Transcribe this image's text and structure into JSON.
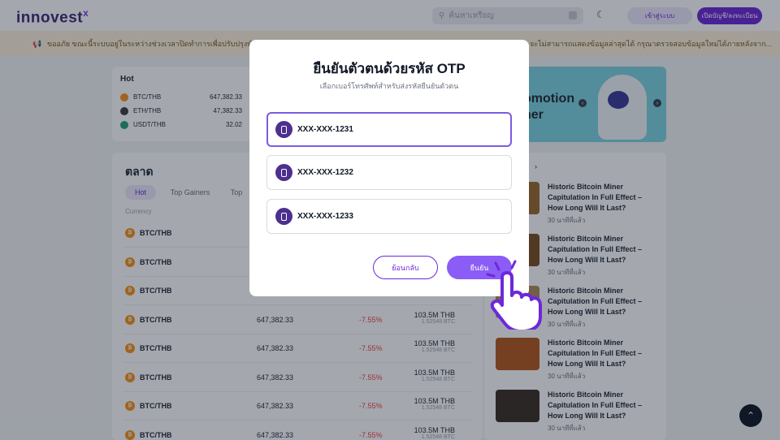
{
  "header": {
    "logo": "innovest",
    "logo_mark": "x",
    "search_placeholder": "ค้นหาเหรียญ",
    "login": "เข้าสู่ระบบ",
    "open_account": "เปิดบัญชี/ลงทะเบียน"
  },
  "notice": {
    "text_left": "ขออภัย ขณะนี้ระบบอยู่ในระหว่างช่วงเวลาปิดทำการเพื่อปรับปรุงพัฒนาการ",
    "text_right": "จะไม่สามารถแสดงข้อมูลล่าสุดได้ กรุณาตรวจสอบข้อมูลใหม่ได้ภายหลังจาก..."
  },
  "hot": {
    "title": "Hot",
    "items": [
      {
        "pair": "BTC/THB",
        "price": "647,382.33",
        "color": "#f7931a",
        "icon": "bitcoin-icon"
      },
      {
        "pair": "ETH/THB",
        "price": "47,382.33",
        "color": "#3c3c3d",
        "icon": "ethereum-icon"
      },
      {
        "pair": "USDT/THB",
        "price": "32.02",
        "color": "#26a17b",
        "icon": "tether-icon"
      }
    ]
  },
  "promo": {
    "line1": "omotion",
    "line2": "ner"
  },
  "market": {
    "title": "ตลาด",
    "tabs": [
      "Hot",
      "Top Gainers",
      "Top"
    ],
    "column_currency": "Currency",
    "rows": [
      {
        "name": "BTC/THB",
        "price": "",
        "change": "",
        "vol": "",
        "vol_sub": ""
      },
      {
        "name": "BTC/THB",
        "price": "",
        "change": "",
        "vol": "",
        "vol_sub": ""
      },
      {
        "name": "BTC/THB",
        "price": "",
        "change": "",
        "vol": "",
        "vol_sub": ""
      },
      {
        "name": "BTC/THB",
        "price": "647,382.33",
        "change": "-7.55%",
        "vol": "103.5M THB",
        "vol_sub": "1.52548 BTC"
      },
      {
        "name": "BTC/THB",
        "price": "647,382.33",
        "change": "-7.55%",
        "vol": "103.5M THB",
        "vol_sub": "1.52548 BTC"
      },
      {
        "name": "BTC/THB",
        "price": "647,382.33",
        "change": "-7.55%",
        "vol": "103.5M THB",
        "vol_sub": "1.52548 BTC"
      },
      {
        "name": "BTC/THB",
        "price": "647,382.33",
        "change": "-7.55%",
        "vol": "103.5M THB",
        "vol_sub": "1.52548 BTC"
      },
      {
        "name": "BTC/THB",
        "price": "647,382.33",
        "change": "-7.55%",
        "vol": "103.5M THB",
        "vol_sub": "1.52548 BTC"
      }
    ]
  },
  "news": {
    "items": [
      {
        "title": "Historic Bitcoin Miner Capitulation In Full Effect – How Long Will It Last?",
        "ago": "30 นาทีที่แล้ว"
      },
      {
        "title": "Historic Bitcoin Miner Capitulation In Full Effect – How Long Will It Last?",
        "ago": "30 นาทีที่แล้ว"
      },
      {
        "title": "Historic Bitcoin Miner Capitulation In Full Effect – How Long Will It Last?",
        "ago": "30 นาทีที่แล้ว"
      },
      {
        "title": "Historic Bitcoin Miner Capitulation In Full Effect – How Long Will It Last?",
        "ago": "30 นาทีที่แล้ว"
      },
      {
        "title": "Historic Bitcoin Miner Capitulation In Full Effect – How Long Will It Last?",
        "ago": "30 นาทีที่แล้ว"
      }
    ]
  },
  "modal": {
    "title": "ยืนยันตัวตนด้วยรหัส OTP",
    "subtitle": "เลือกเบอร์โทรศัพท์สำหรับส่งรหัสยืนยันตัวตน",
    "phones": [
      "XXX-XXX-1231",
      "XXX-XXX-1232",
      "XXX-XXX-1233"
    ],
    "selected_index": 0,
    "cancel": "ย้อนกลับ",
    "confirm": "ยืนยัน"
  },
  "colors": {
    "brand": "#6d28d9",
    "accent": "#8b5cf6",
    "negative": "#ef4444"
  }
}
